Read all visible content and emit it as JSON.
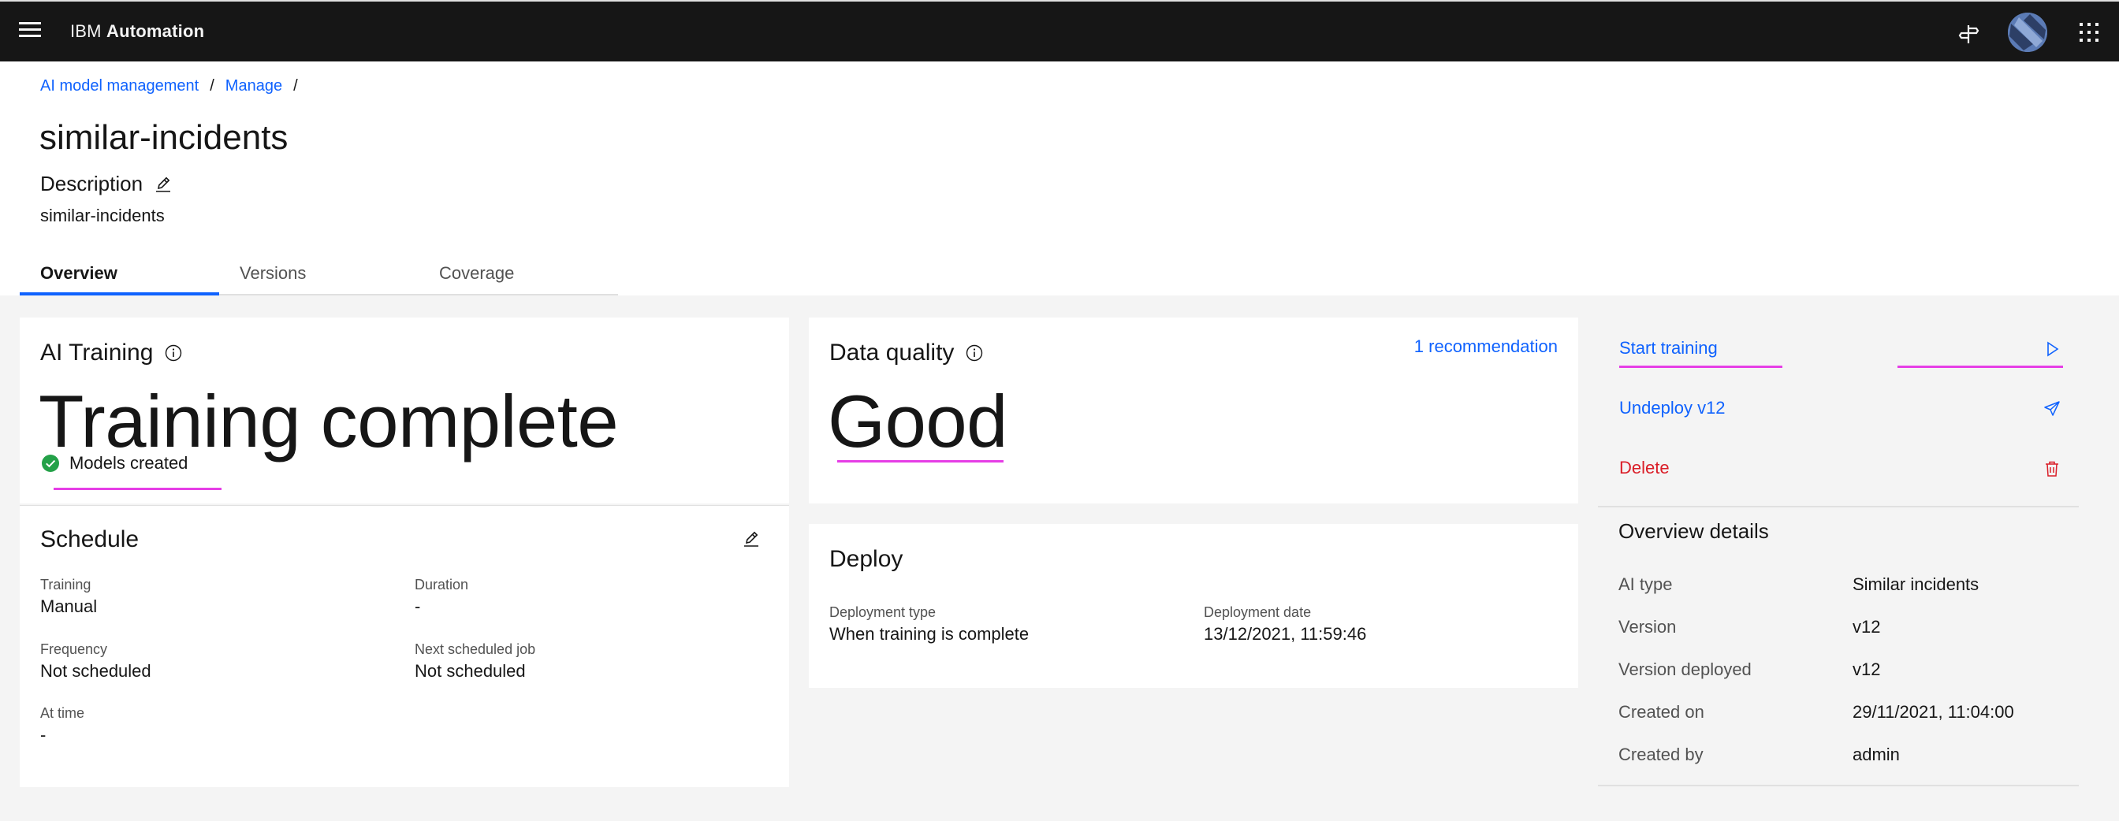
{
  "topbar": {
    "brand_prefix": "IBM",
    "brand_name": "Automation"
  },
  "breadcrumb": {
    "items": [
      "AI model management",
      "Manage"
    ],
    "separator": "/"
  },
  "page": {
    "title": "similar-incidents",
    "description_label": "Description",
    "description_value": "similar-incidents"
  },
  "tabs": [
    "Overview",
    "Versions",
    "Coverage"
  ],
  "active_tab": "Overview",
  "ai_training": {
    "title": "AI Training",
    "status": "Training complete",
    "substatus": "Models created"
  },
  "schedule": {
    "title": "Schedule",
    "fields": [
      {
        "label": "Training",
        "value": "Manual"
      },
      {
        "label": "Duration",
        "value": "-"
      },
      {
        "label": "Frequency",
        "value": "Not scheduled"
      },
      {
        "label": "Next scheduled job",
        "value": "Not scheduled"
      },
      {
        "label": "At time",
        "value": "-"
      }
    ]
  },
  "data_quality": {
    "title": "Data quality",
    "value": "Good",
    "recommendation_link": "1 recommendation"
  },
  "deploy": {
    "title": "Deploy",
    "fields": [
      {
        "label": "Deployment type",
        "value": "When training is complete"
      },
      {
        "label": "Deployment date",
        "value": "13/12/2021, 11:59:46"
      }
    ]
  },
  "actions": [
    {
      "label": "Start training",
      "icon": "play-icon"
    },
    {
      "label": "Undeploy v12",
      "icon": "send-icon"
    },
    {
      "label": "Delete",
      "icon": "trash-icon"
    }
  ],
  "overview_details": {
    "title": "Overview details",
    "rows": [
      {
        "key": "AI type",
        "value": "Similar incidents"
      },
      {
        "key": "Version",
        "value": "v12"
      },
      {
        "key": "Version deployed",
        "value": "v12"
      },
      {
        "key": "Created on",
        "value": "29/11/2021, 11:04:00"
      },
      {
        "key": "Created by",
        "value": "admin"
      }
    ]
  },
  "colors": {
    "topbar_bg": "#161616",
    "link_blue": "#0f62fe",
    "danger_red": "#da1e28",
    "success_green": "#24a148",
    "annotation_pink": "#e63ee6"
  }
}
